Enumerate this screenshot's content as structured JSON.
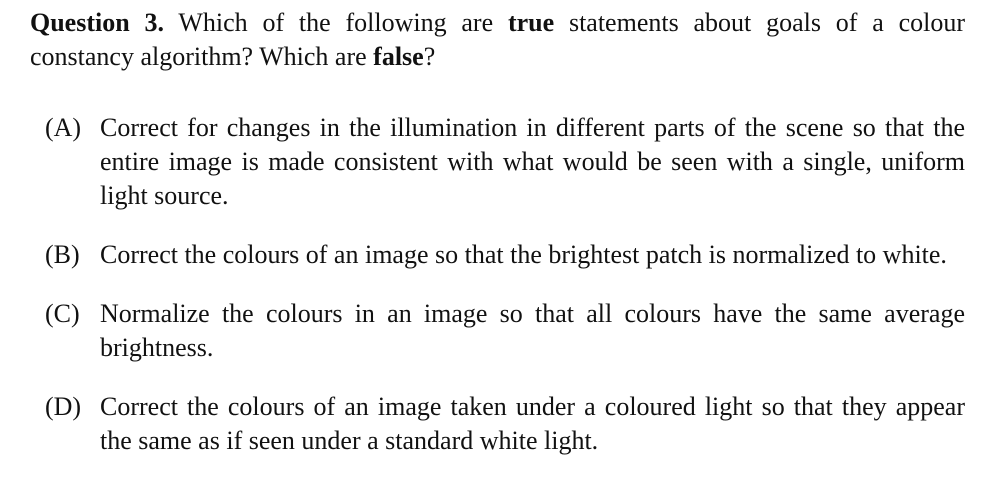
{
  "question": {
    "label": "Question 3.",
    "text_1": " Which of the following are ",
    "true_word": "true",
    "text_2": " statements about goals of a colour constancy algorithm? Which are ",
    "false_word": "false",
    "text_3": "?"
  },
  "options": [
    {
      "letter": "(A)",
      "text": "Correct for changes in the illumination in different parts of the scene so that the entire image is made consistent with what would be seen with a single, uniform light source."
    },
    {
      "letter": "(B)",
      "text": "Correct the colours of an image so that the brightest patch is normalized to white."
    },
    {
      "letter": "(C)",
      "text": "Normalize the colours in an image so that all colours have the same average brightness."
    },
    {
      "letter": "(D)",
      "text": "Correct the colours of an image taken under a coloured light so that they appear the same as if seen under a standard white light."
    }
  ]
}
